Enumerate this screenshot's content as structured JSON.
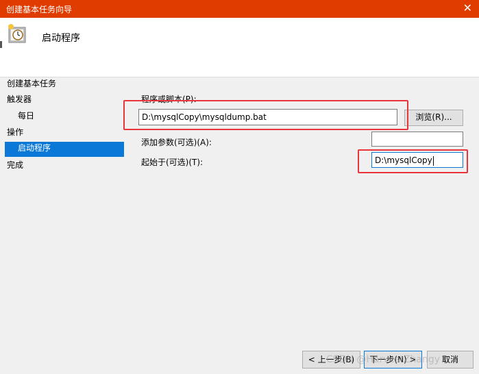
{
  "window": {
    "title": "创建基本任务向导",
    "close_glyph": "✕"
  },
  "header": {
    "title": "启动程序"
  },
  "sidebar": {
    "items": [
      {
        "label": "创建基本任务"
      },
      {
        "label": "触发器"
      },
      {
        "label": "每日"
      },
      {
        "label": "操作"
      },
      {
        "label": "启动程序"
      },
      {
        "label": "完成"
      }
    ]
  },
  "form": {
    "program_label": "程序或脚本(P):",
    "program_value": "D:\\mysqlCopy\\mysqldump.bat",
    "browse_label": "浏览(R)...",
    "args_label": "添加参数(可选)(A):",
    "args_value": "",
    "start_label": "起始于(可选)(T):",
    "start_value": "D:\\mysqlCopy"
  },
  "footer": {
    "back_label": "< 上一步(B)",
    "next_label": "下一步(N) >",
    "cancel_label": "取消"
  },
  "watermark": "CSDN @HarvestZhangy",
  "colors": {
    "titlebar": "#e03c00",
    "selection": "#0a78d7",
    "highlight_box": "#e8343a"
  }
}
